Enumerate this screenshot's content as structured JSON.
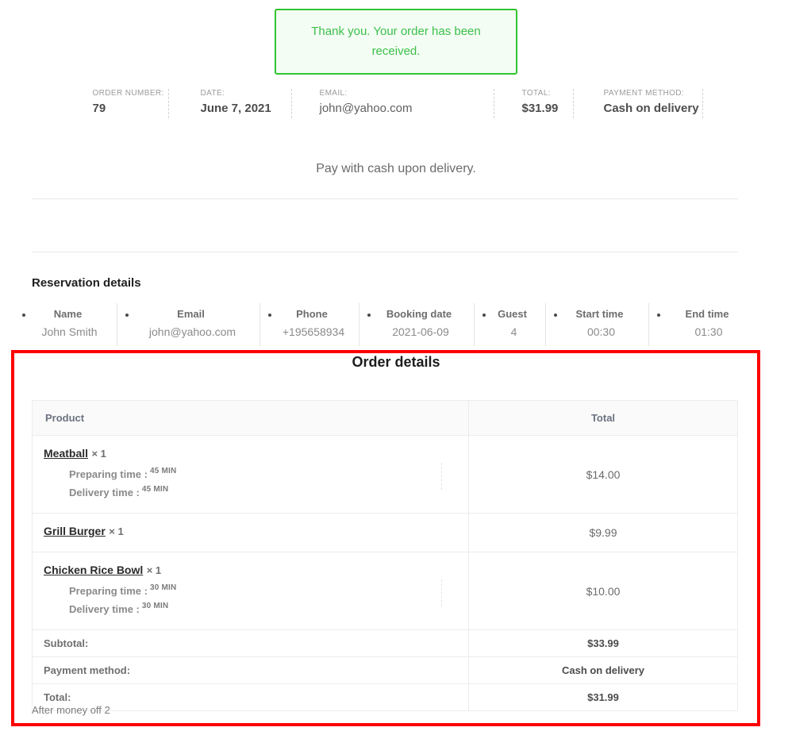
{
  "notice": {
    "message": "Thank you. Your order has been received."
  },
  "order_meta": [
    {
      "label": "ORDER NUMBER:",
      "value": "79",
      "bold": true
    },
    {
      "label": "DATE:",
      "value": "June 7, 2021",
      "bold": true
    },
    {
      "label": "EMAIL:",
      "value": "john@yahoo.com",
      "bold": false
    },
    {
      "label": "TOTAL:",
      "value": "$31.99",
      "bold": true
    },
    {
      "label": "PAYMENT METHOD:",
      "value": "Cash on delivery",
      "bold": true
    }
  ],
  "payment_note": "Pay with cash upon delivery.",
  "reservation": {
    "heading": "Reservation details",
    "items": [
      {
        "label": "Name",
        "value": "John Smith"
      },
      {
        "label": "Email",
        "value": "john@yahoo.com"
      },
      {
        "label": "Phone",
        "value": "+195658934"
      },
      {
        "label": "Booking date",
        "value": "2021-06-09"
      },
      {
        "label": "Guest",
        "value": "4"
      },
      {
        "label": "Start time",
        "value": "00:30"
      },
      {
        "label": "End time",
        "value": "01:30"
      }
    ]
  },
  "order_details": {
    "heading": "Order details",
    "columns": {
      "product": "Product",
      "total": "Total"
    },
    "items": [
      {
        "name": "Meatball",
        "qty": "× 1",
        "preparing_label": "Preparing time :",
        "preparing_value": "45 MIN",
        "delivery_label": "Delivery time :",
        "delivery_value": "45 MIN",
        "total": "$14.00"
      },
      {
        "name": "Grill Burger",
        "qty": "× 1",
        "preparing_label": "",
        "preparing_value": "",
        "delivery_label": "",
        "delivery_value": "",
        "total": "$9.99"
      },
      {
        "name": "Chicken Rice Bowl",
        "qty": "× 1",
        "preparing_label": "Preparing time :",
        "preparing_value": "30 MIN",
        "delivery_label": "Delivery time :",
        "delivery_value": "30 MIN",
        "total": "$10.00"
      }
    ],
    "totals": [
      {
        "label": "Subtotal:",
        "value": "$33.99"
      },
      {
        "label": "Payment method:",
        "value": "Cash on delivery"
      },
      {
        "label": "Total:",
        "value": "$31.99"
      }
    ]
  },
  "footnote": "After money off 2",
  "colors": {
    "notice_border": "#2fc52f",
    "notice_text": "#3bbf4a",
    "notice_bg": "#f4fdf4",
    "highlight_box": "#fe0000"
  }
}
